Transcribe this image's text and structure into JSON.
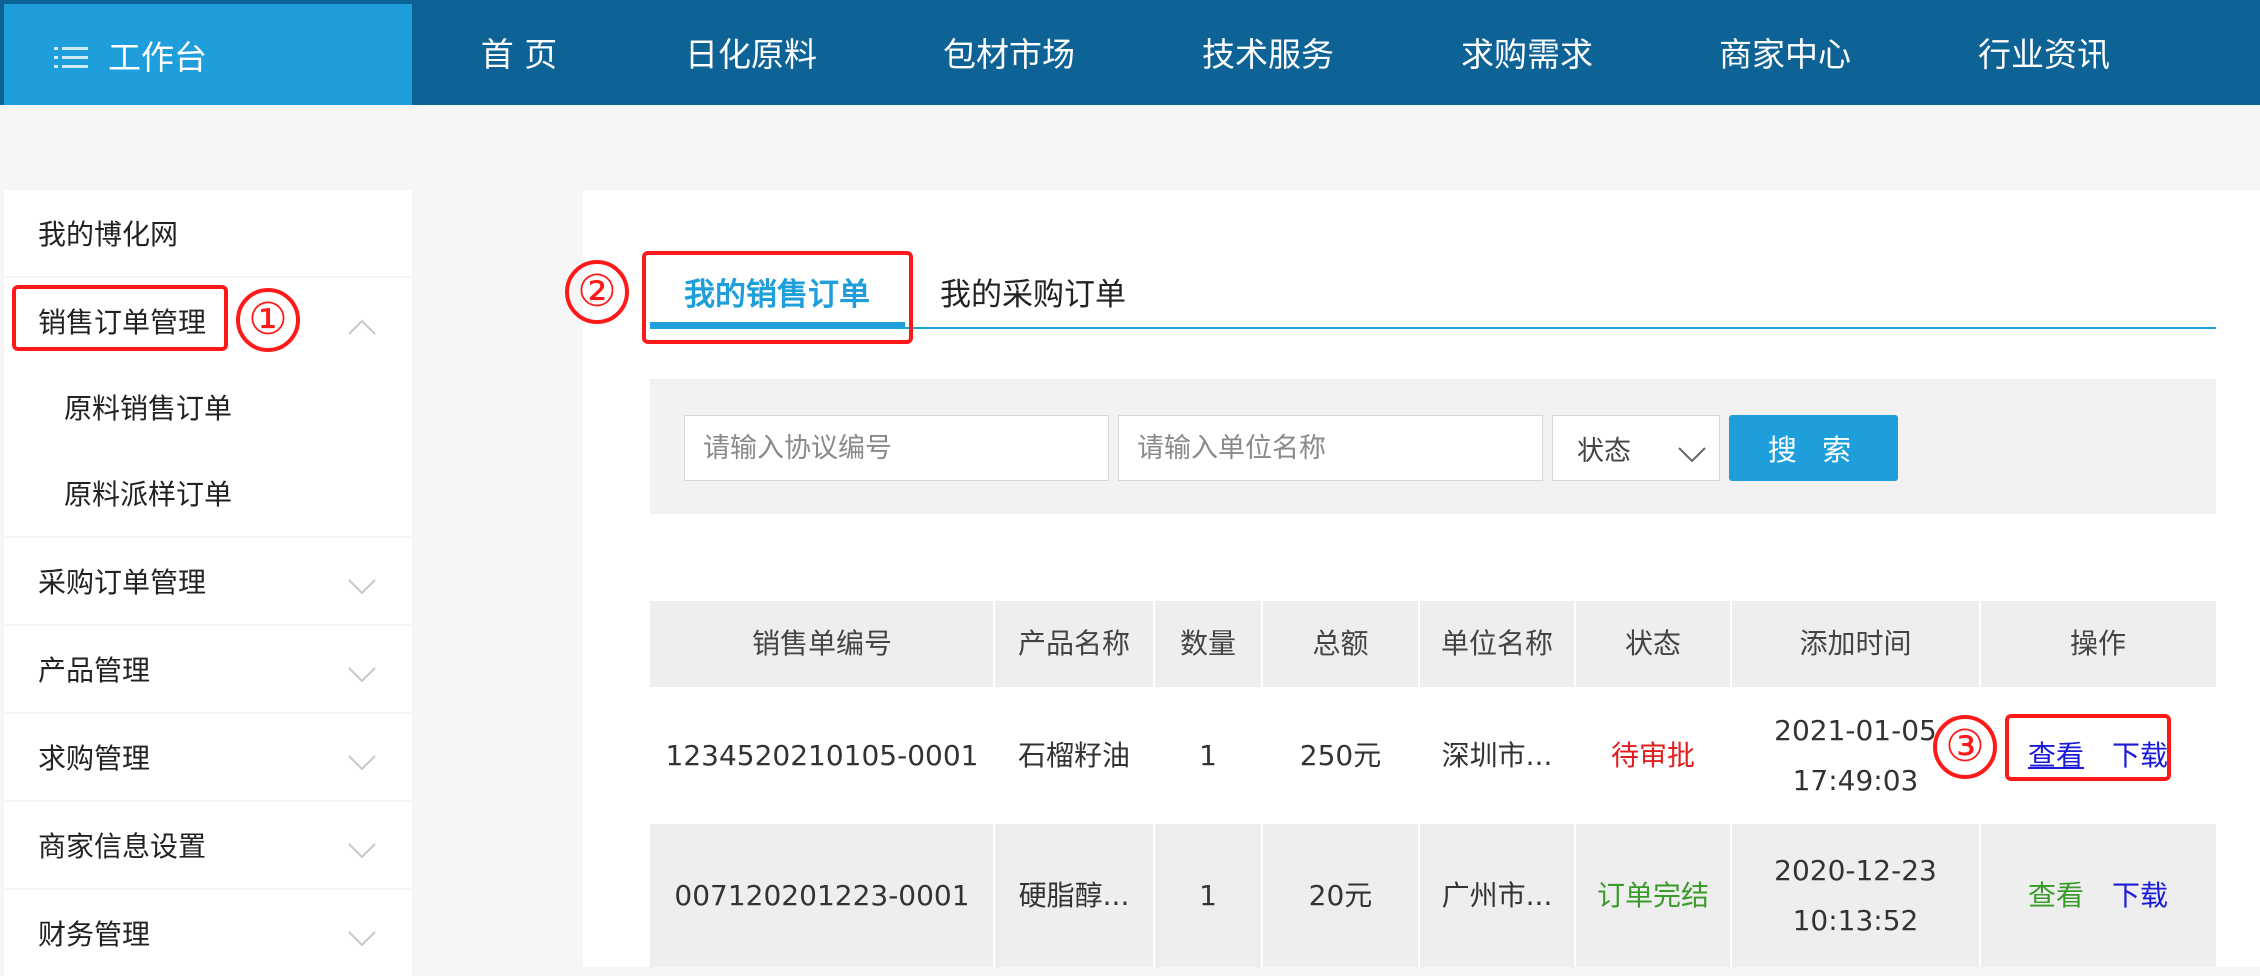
{
  "colors": {
    "nav_bg": "#0d6296",
    "brand_bg": "#1e9fdc",
    "accent": "#1e9fdc",
    "annotation": "#ff1a1a",
    "status_pending": "#e02020",
    "status_done": "#3a9a2a",
    "link_blue": "#1a1ad8",
    "link_green": "#3a9a2a"
  },
  "header": {
    "brand_label": "工作台",
    "brand_icon": "menu-icon",
    "nav": [
      "首 页",
      "日化原料",
      "包材市场",
      "技术服务",
      "求购需求",
      "商家中心",
      "行业资讯"
    ]
  },
  "sidebar": {
    "items": [
      {
        "label": "我的博化网",
        "chevron": null
      },
      {
        "label": "销售订单管理",
        "chevron": "chevron-up-icon"
      },
      {
        "label": "原料销售订单",
        "chevron": null
      },
      {
        "label": "原料派样订单",
        "chevron": null
      },
      {
        "label": "采购订单管理",
        "chevron": "chevron-down-icon"
      },
      {
        "label": "产品管理",
        "chevron": "chevron-down-icon"
      },
      {
        "label": "求购管理",
        "chevron": "chevron-down-icon"
      },
      {
        "label": "商家信息设置",
        "chevron": "chevron-down-icon"
      },
      {
        "label": "财务管理",
        "chevron": "chevron-down-icon"
      }
    ]
  },
  "annotations": {
    "one": "①",
    "two": "②",
    "three": "③"
  },
  "tabs": {
    "active": "我的销售订单",
    "inactive": "我的采购订单"
  },
  "search": {
    "agreement_placeholder": "请输入协议编号",
    "company_placeholder": "请输入单位名称",
    "status_label": "状态",
    "button_label": "搜 索"
  },
  "table": {
    "headers": [
      "销售单编号",
      "产品名称",
      "数量",
      "总额",
      "单位名称",
      "状态",
      "添加时间",
      "操作"
    ],
    "rows": [
      {
        "order_no": "1234520210105-0001",
        "product": "石榴籽油",
        "qty": "1",
        "total": "250元",
        "company": "深圳市...",
        "status": "待审批",
        "date": "2021-01-05",
        "time": "17:49:03",
        "view": "查看",
        "download": "下载"
      },
      {
        "order_no": "007120201223-0001",
        "product": "硬脂醇...",
        "qty": "1",
        "total": "20元",
        "company": "广州市...",
        "status": "订单完结",
        "date": "2020-12-23",
        "time": "10:13:52",
        "view": "查看",
        "download": "下载"
      }
    ]
  }
}
